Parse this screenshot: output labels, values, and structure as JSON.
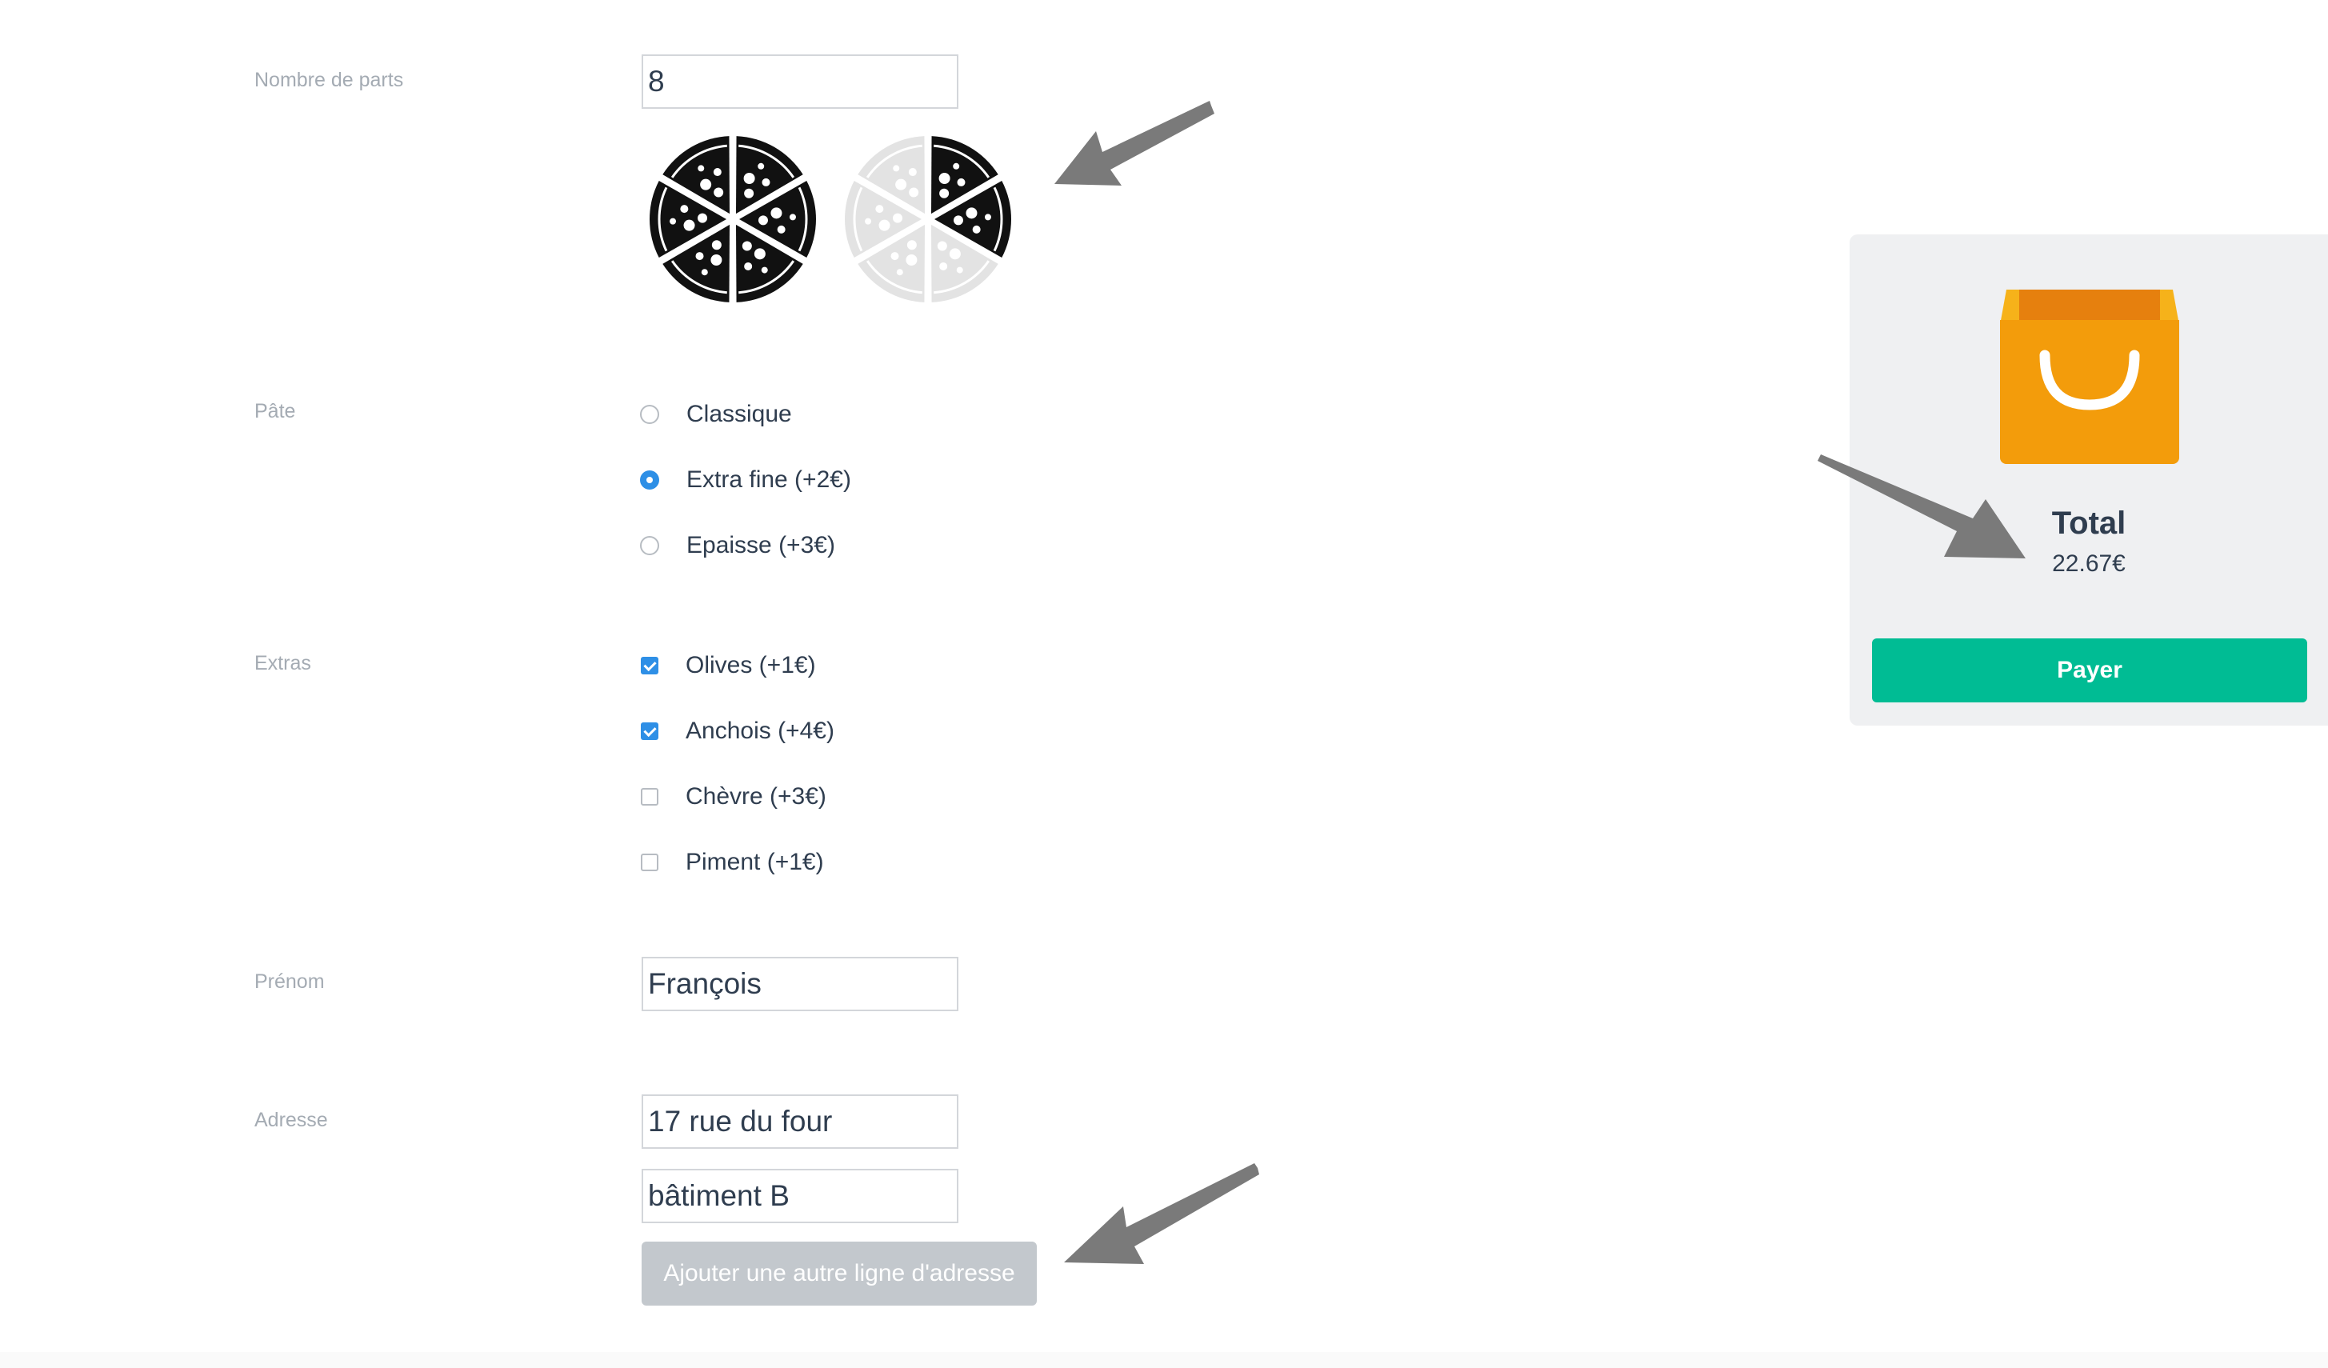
{
  "form": {
    "slices": {
      "label": "Nombre de parts",
      "value": "8",
      "pizza_fill_fraction_second": 0.375
    },
    "crust": {
      "label": "Pâte",
      "options": [
        {
          "label": "Classique",
          "checked": false
        },
        {
          "label": "Extra fine (+2€)",
          "checked": true
        },
        {
          "label": "Epaisse (+3€)",
          "checked": false
        }
      ]
    },
    "extras": {
      "label": "Extras",
      "options": [
        {
          "label": "Olives (+1€)",
          "checked": true
        },
        {
          "label": "Anchois (+4€)",
          "checked": true
        },
        {
          "label": "Chèvre (+3€)",
          "checked": false
        },
        {
          "label": "Piment (+1€)",
          "checked": false
        }
      ]
    },
    "firstname": {
      "label": "Prénom",
      "value": "François"
    },
    "address": {
      "label": "Adresse",
      "lines": [
        "17 rue du four",
        "bâtiment B"
      ],
      "add_line_label": "Ajouter une autre ligne d'adresse"
    }
  },
  "cart": {
    "icon": "shopping-bag-icon",
    "total_label": "Total",
    "total_value": "22.67€",
    "pay_label": "Payer"
  },
  "colors": {
    "accent_blue": "#2e8fe6",
    "pay_green": "#00bc94",
    "bag_orange": "#f39c0b",
    "bag_dark_orange": "#e6800e",
    "disabled_button": "#c3c8cd",
    "label_gray": "#a4abb3",
    "text_dark": "#2f3d4f",
    "annotation_arrow": "#7a7a7a"
  }
}
